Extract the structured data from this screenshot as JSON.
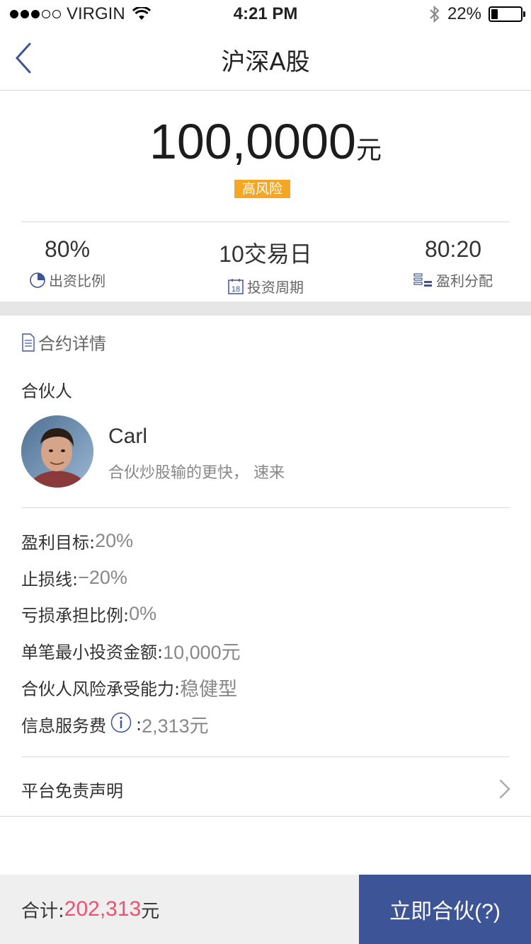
{
  "status_bar": {
    "carrier": "VIRGIN",
    "time": "4:21 PM",
    "battery": "22%",
    "battery_level": 0.22
  },
  "nav": {
    "title": "沪深A股",
    "back_icon": "chevron-left-icon"
  },
  "summary": {
    "amount": "100,0000",
    "amount_unit": "元",
    "risk_badge": "高风险",
    "risk_color": "#f5a623"
  },
  "stats": [
    {
      "value": "80%",
      "label": "出资比例",
      "icon": "pie-chart-icon"
    },
    {
      "value": "10交易日",
      "label": "投资周期",
      "icon": "calendar-icon",
      "icon_text": "18"
    },
    {
      "value": "80:20",
      "label": "盈利分配",
      "icon": "stack-icon"
    }
  ],
  "contract": {
    "section_title": "合约详情",
    "partner_label": "合伙人",
    "partner": {
      "name": "Carl",
      "quote": "合伙炒股输的更快， 速来"
    },
    "details": [
      {
        "label": "盈利目标:",
        "value": " 20%"
      },
      {
        "label": "止损线:",
        "value": " −20%"
      },
      {
        "label": "亏损承担比例:",
        "value": " 0%"
      },
      {
        "label": "单笔最小投资金额:",
        "value": " 10,000元"
      },
      {
        "label": "合伙人风险承受能力:",
        "value": " 稳健型"
      },
      {
        "label": "信息服务费",
        "separator": ":",
        "value": " 2,313元"
      }
    ],
    "disclaimer": "平台免责声明"
  },
  "footer": {
    "total_label": "合计:",
    "total_value": "202,313",
    "total_unit": "元",
    "total_color": "#f0506e",
    "cta_label": "立即合伙(?)",
    "cta_color": "#3d5497"
  }
}
